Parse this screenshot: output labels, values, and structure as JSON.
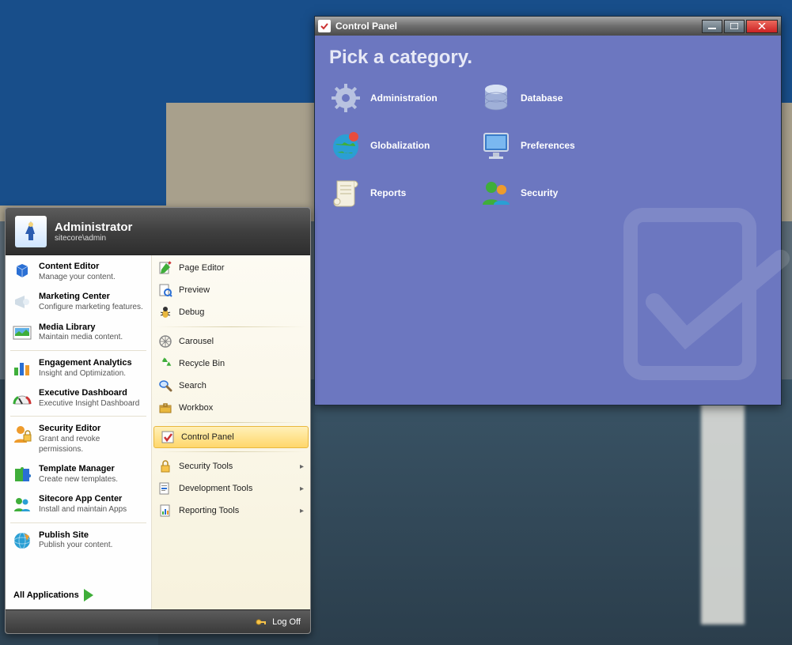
{
  "startMenu": {
    "userName": "Administrator",
    "userSub": "sitecore\\admin",
    "leftItems": [
      {
        "title": "Content Editor",
        "desc": "Manage your content.",
        "icon": "cube-icon",
        "color": "#2a6fd4"
      },
      {
        "title": "Marketing Center",
        "desc": "Configure marketing features.",
        "icon": "bullhorn-icon",
        "color": "#b8c8d6"
      },
      {
        "title": "Media Library",
        "desc": "Maintain media content.",
        "icon": "picture-icon",
        "color": "#3fae3a"
      },
      {
        "title": "Engagement Analytics",
        "desc": "Insight and Optimization.",
        "icon": "barchart-icon",
        "color": "#3fae3a"
      },
      {
        "title": "Executive Dashboard",
        "desc": "Executive Insight Dashboard",
        "icon": "gauge-icon",
        "color": "#cc3b2e"
      },
      {
        "title": "Security Editor",
        "desc": "Grant and revoke permissions.",
        "icon": "user-lock-icon",
        "color": "#ee9b2c"
      },
      {
        "title": "Template Manager",
        "desc": "Create new templates.",
        "icon": "puzzle-icon",
        "color": "#3fae3a"
      },
      {
        "title": "Sitecore App Center",
        "desc": "Install and maintain Apps",
        "icon": "people-icon",
        "color": "#2a9fd4"
      },
      {
        "title": "Publish Site",
        "desc": "Publish your content.",
        "icon": "globe-publish-icon",
        "color": "#2a9fd4"
      }
    ],
    "allApps": "All Applications",
    "rightItems": [
      {
        "label": "Page Editor",
        "icon": "page-edit-icon",
        "submenu": false
      },
      {
        "label": "Preview",
        "icon": "preview-icon",
        "submenu": false
      },
      {
        "label": "Debug",
        "icon": "bug-icon",
        "submenu": false
      },
      {
        "label": "Carousel",
        "icon": "carousel-icon",
        "submenu": false
      },
      {
        "label": "Recycle Bin",
        "icon": "recycle-icon",
        "submenu": false
      },
      {
        "label": "Search",
        "icon": "search-icon",
        "submenu": false
      },
      {
        "label": "Workbox",
        "icon": "workbox-icon",
        "submenu": false
      }
    ],
    "rightItemsSelected": {
      "label": "Control Panel",
      "icon": "controlpanel-icon"
    },
    "rightItemsSub": [
      {
        "label": "Security Tools",
        "icon": "lock-icon",
        "submenu": true
      },
      {
        "label": "Development Tools",
        "icon": "devtools-icon",
        "submenu": true
      },
      {
        "label": "Reporting Tools",
        "icon": "report-icon",
        "submenu": true
      }
    ],
    "logOff": "Log Off"
  },
  "controlPanel": {
    "windowTitle": "Control Panel",
    "heading": "Pick a category.",
    "categories": [
      {
        "label": "Administration",
        "icon": "gear-icon"
      },
      {
        "label": "Database",
        "icon": "database-icon"
      },
      {
        "label": "Globalization",
        "icon": "globe-icon"
      },
      {
        "label": "Preferences",
        "icon": "monitor-icon"
      },
      {
        "label": "Reports",
        "icon": "scroll-icon"
      },
      {
        "label": "Security",
        "icon": "users-icon"
      }
    ]
  }
}
